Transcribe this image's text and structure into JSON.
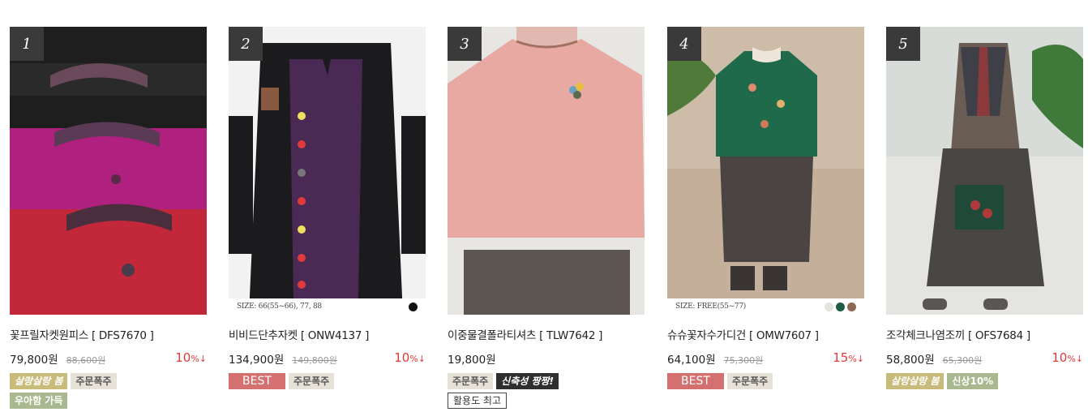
{
  "products": [
    {
      "rank": "1",
      "name": "꽃프릴자켓원피스 [ DFS7670 ]",
      "price": "79,800원",
      "original_price": "88,600원",
      "discount": "10",
      "discount_unit": "%↓",
      "badges": [
        "살랑살랑 봄",
        "주문폭주",
        "우아함 가득"
      ]
    },
    {
      "rank": "2",
      "name": "비비드단추자켓 [ ONW4137 ]",
      "price": "134,900원",
      "original_price": "149,800원",
      "discount": "10",
      "discount_unit": "%↓",
      "size_text": "SIZE: 66(55~66), 77, 88",
      "swatch_colors": [
        "#111111"
      ],
      "badges": [
        "BEST",
        "주문폭주"
      ]
    },
    {
      "rank": "3",
      "name": "이중물결폴라티셔츠 [ TLW7642 ]",
      "price": "19,800원",
      "badges": [
        "주문폭주",
        "신축성 짱짱!",
        "활용도 최고"
      ]
    },
    {
      "rank": "4",
      "name": "슈슈꽃자수가디건 [ OMW7607 ]",
      "price": "64,100원",
      "original_price": "75,300원",
      "discount": "15",
      "discount_unit": "%↓",
      "size_text": "SIZE: FREE(55~77)",
      "swatch_colors": [
        "#e6e2dc",
        "#1f5c43",
        "#8a6a55"
      ],
      "badges": [
        "BEST",
        "주문폭주"
      ]
    },
    {
      "rank": "5",
      "name": "조각체크나염조끼 [ OFS7684 ]",
      "price": "58,800원",
      "original_price": "65,300원",
      "discount": "10",
      "discount_unit": "%↓",
      "badges": [
        "살랑살랑 봄",
        "신상10%"
      ]
    }
  ],
  "colors": {
    "discount": "#e03a3a",
    "rank_box": "#3a3a3a",
    "badge_yellow": "#c9bb7a",
    "badge_beige": "#e6e2d8",
    "badge_green": "#a9b98f",
    "badge_red": "#d47070",
    "badge_dark": "#2f2f2f"
  }
}
